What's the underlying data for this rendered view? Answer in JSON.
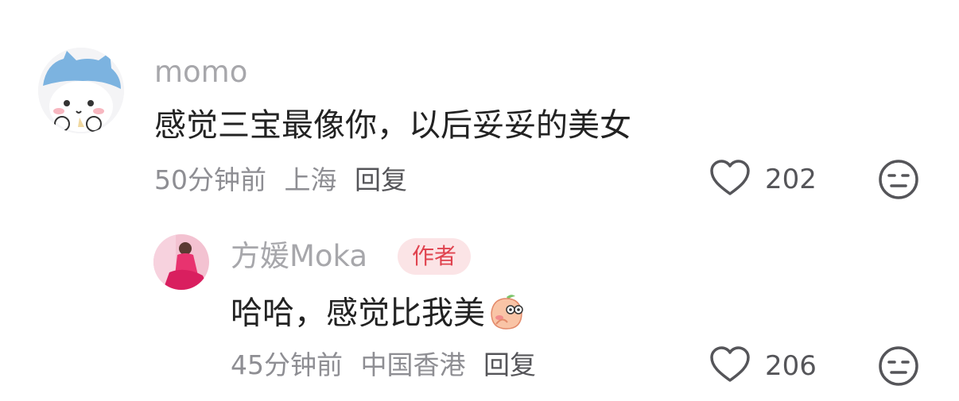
{
  "comments": [
    {
      "username": "momo",
      "text": "感觉三宝最像你，以后妥妥的美女",
      "time": "50分钟前",
      "location": "上海",
      "reply_label": "回复",
      "likes": "202"
    }
  ],
  "reply": {
    "username": "方媛Moka",
    "author_badge": "作者",
    "text": "哈哈，感觉比我美",
    "time": "45分钟前",
    "location": "中国香港",
    "reply_label": "回复",
    "likes": "206"
  },
  "icons": {
    "like": "heart-icon",
    "dislike": "unamused-face-icon",
    "emoji": "peach-shy-emoji"
  },
  "colors": {
    "badge_text": "#e0434f",
    "badge_bg": "#fbe4e6",
    "secondary_text": "#8e8e93"
  }
}
